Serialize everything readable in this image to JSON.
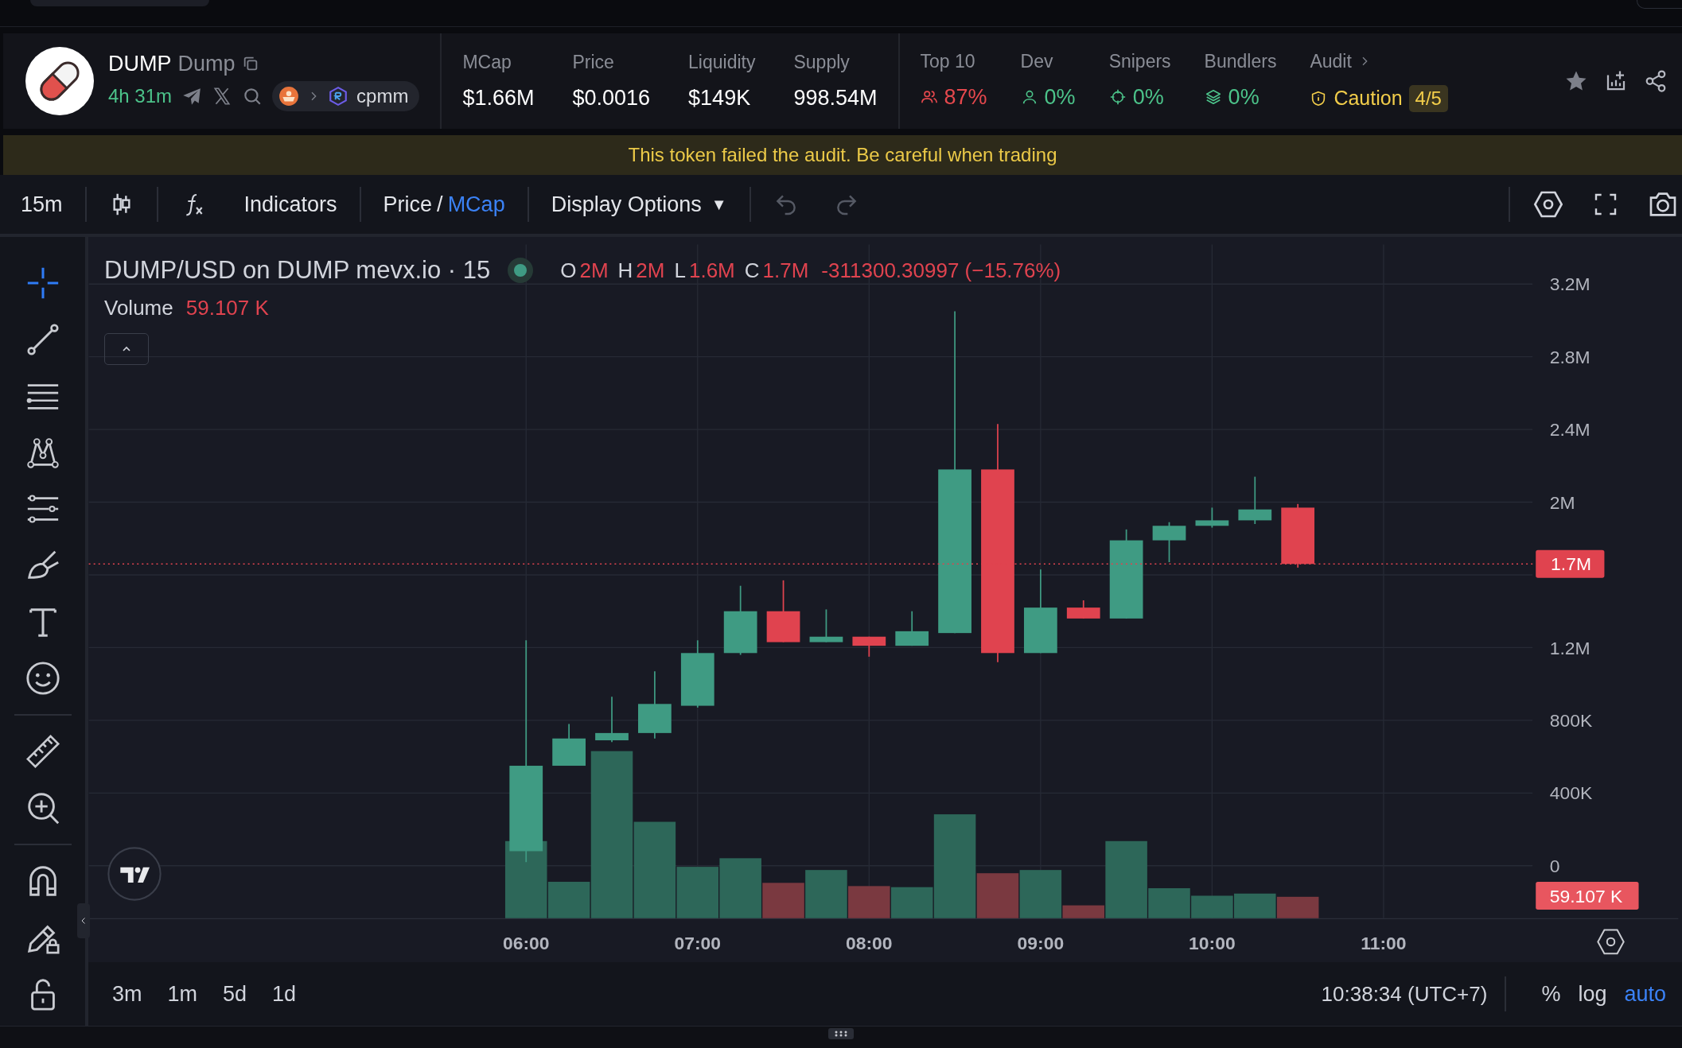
{
  "token": {
    "symbol": "DUMP",
    "name": "Dump",
    "age": "4h 31m",
    "pool": "cpmm"
  },
  "stats": [
    {
      "label": "MCap",
      "value": "$1.66M"
    },
    {
      "label": "Price",
      "value": "$0.0016"
    },
    {
      "label": "Liquidity",
      "value": "$149K"
    },
    {
      "label": "Supply",
      "value": "998.54M"
    }
  ],
  "risks": [
    {
      "label": "Top 10",
      "value": "87%",
      "kind": "holders",
      "color": "#e5484d"
    },
    {
      "label": "Dev",
      "value": "0%",
      "kind": "dev",
      "color": "#4cc38a"
    },
    {
      "label": "Snipers",
      "value": "0%",
      "kind": "snipers",
      "color": "#4cc38a"
    },
    {
      "label": "Bundlers",
      "value": "0%",
      "kind": "bundlers",
      "color": "#4cc38a"
    }
  ],
  "audit": {
    "label": "Audit",
    "status": "Caution",
    "score": "4/5"
  },
  "banner": "This token failed the audit. Be careful when trading",
  "toolbar": {
    "interval": "15m",
    "indicators": "Indicators",
    "price_modes": [
      {
        "label": "Price",
        "selected": false
      },
      {
        "label": "MCap",
        "selected": true
      }
    ],
    "separator": "/",
    "display_options": "Display Options",
    "caret": "▼"
  },
  "legend": {
    "title": "DUMP/USD on DUMP mevx.io · 15",
    "ohlc": [
      {
        "key": "O",
        "value": "2M"
      },
      {
        "key": "H",
        "value": "2M"
      },
      {
        "key": "L",
        "value": "1.6M"
      },
      {
        "key": "C",
        "value": "1.7M"
      }
    ],
    "change": "-311300.30997 (−15.76%)",
    "volume_label": "Volume",
    "volume_value": "59.107 K"
  },
  "chart": {
    "kind": "picture",
    "last_price_label": "1.7M",
    "last_volume_label": "59.107 K",
    "price_axis": [
      "3.2M",
      "2.8M",
      "2.4M",
      "2M",
      "1.2M",
      "800K",
      "400K",
      "0"
    ],
    "time_axis": [
      "06:00",
      "07:00",
      "08:00",
      "09:00",
      "10:00",
      "11:00"
    ]
  },
  "timeframes": [
    "3m",
    "1m",
    "5d",
    "1d"
  ],
  "clock": "10:38:34 (UTC+7)",
  "scale_options": [
    {
      "label": "%",
      "selected": false
    },
    {
      "label": "log",
      "selected": false
    },
    {
      "label": "auto",
      "selected": true
    }
  ]
}
